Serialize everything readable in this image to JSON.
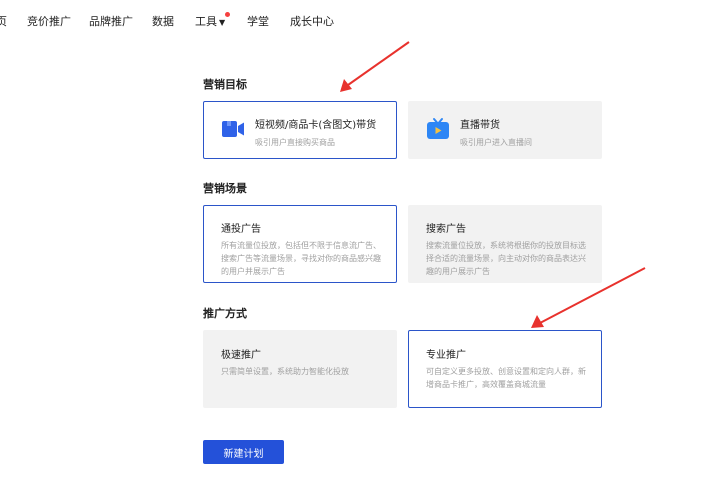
{
  "nav": {
    "items": [
      {
        "label": "页"
      },
      {
        "label": "竞价推广"
      },
      {
        "label": "品牌推广"
      },
      {
        "label": "数据"
      },
      {
        "label": "工具"
      },
      {
        "label": "学堂"
      },
      {
        "label": "成长中心"
      }
    ],
    "dot_color": "#f5403f"
  },
  "marketing_goal": {
    "title": "营销目标",
    "options": [
      {
        "title": "短视频/商品卡(含图文)带货",
        "desc": "吸引用户直接购买商品",
        "icon": "video-camera-icon",
        "selected": true
      },
      {
        "title": "直播带货",
        "desc": "吸引用户进入直播间",
        "icon": "tv-icon",
        "selected": false
      }
    ]
  },
  "marketing_scene": {
    "title": "营销场景",
    "options": [
      {
        "title": "通投广告",
        "desc": "所有流量位投放，包括但不限于信息流广告、搜索广告等流量场景，寻找对你的商品感兴趣的用户并展示广告",
        "selected": true
      },
      {
        "title": "搜索广告",
        "desc": "搜索流量位投放，系统将根据你的投放目标选择合适的流量场景，向主动对你的商品表达兴趣的用户展示广告",
        "selected": false
      }
    ]
  },
  "promotion_method": {
    "title": "推广方式",
    "options": [
      {
        "title": "极速推广",
        "desc": "只需简单设置，系统助力智能化投放",
        "selected": false
      },
      {
        "title": "专业推广",
        "desc": "可自定义更多投放、创意设置和定向人群，新增商品卡推广，高效覆盖商城流量",
        "selected": true
      }
    ]
  },
  "create_button": {
    "label": "新建计划"
  },
  "colors": {
    "accent": "#2451d9",
    "selected_border": "#2b55c9",
    "annotation_arrow": "#e8322d"
  }
}
